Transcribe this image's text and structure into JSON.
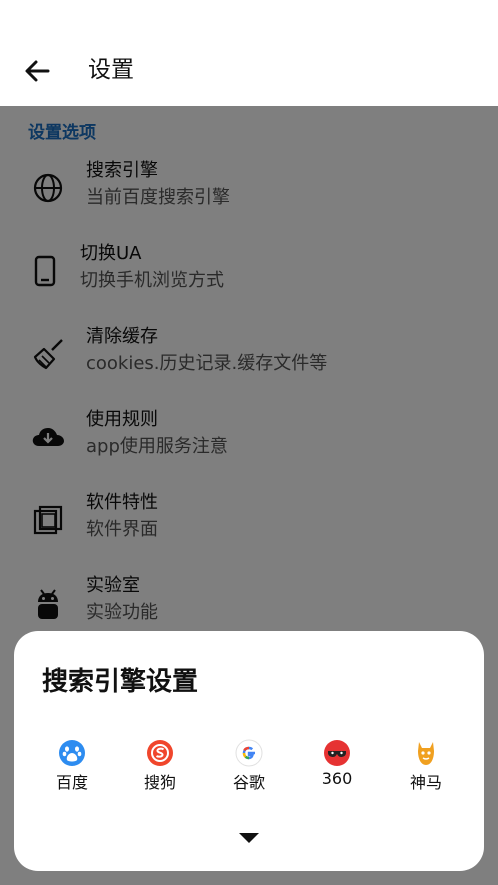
{
  "header": {
    "title": "设置"
  },
  "section": {
    "title": "设置选项"
  },
  "settings": [
    {
      "title": "搜索引擎",
      "subtitle": "当前百度搜索引擎"
    },
    {
      "title": "切换UA",
      "subtitle": "切换手机浏览方式"
    },
    {
      "title": "清除缓存",
      "subtitle": "cookies.历史记录.缓存文件等"
    },
    {
      "title": "使用规则",
      "subtitle": "app使用服务注意"
    },
    {
      "title": "软件特性",
      "subtitle": "软件界面"
    },
    {
      "title": "实验室",
      "subtitle": "实验功能"
    }
  ],
  "sheet": {
    "title": "搜索引擎设置",
    "engines": [
      {
        "label": "百度",
        "icon": "baidu-icon",
        "color": "#2d8cf0"
      },
      {
        "label": "搜狗",
        "icon": "sogou-icon",
        "color": "#f0462c"
      },
      {
        "label": "谷歌",
        "icon": "google-icon",
        "color": "#4285f4"
      },
      {
        "label": "360",
        "icon": "360-icon",
        "color": "#e63232"
      },
      {
        "label": "神马",
        "icon": "shenma-icon",
        "color": "#f0a020"
      }
    ]
  },
  "colors": {
    "accent": "#1a6fc3",
    "overlay": "rgba(0,0,0,0.5)"
  }
}
